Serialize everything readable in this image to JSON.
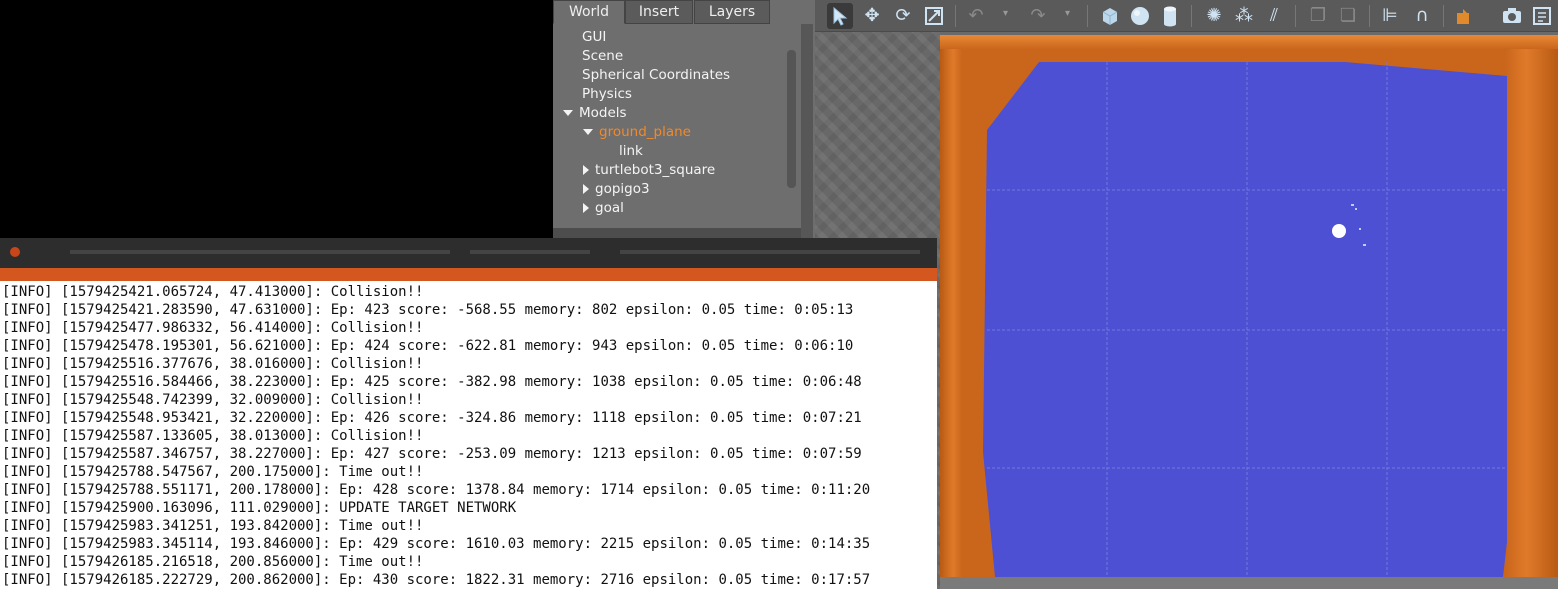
{
  "left_panel": {
    "tabs": [
      {
        "label": "World",
        "active": true
      },
      {
        "label": "Insert",
        "active": false
      },
      {
        "label": "Layers",
        "active": false
      }
    ],
    "tree": [
      {
        "label": "GUI",
        "level": 0,
        "arrow": "none",
        "selected": false
      },
      {
        "label": "Scene",
        "level": 0,
        "arrow": "none",
        "selected": false
      },
      {
        "label": "Spherical Coordinates",
        "level": 0,
        "arrow": "none",
        "selected": false
      },
      {
        "label": "Physics",
        "level": 0,
        "arrow": "none",
        "selected": false
      },
      {
        "label": "Models",
        "level": 0,
        "arrow": "down",
        "selected": false
      },
      {
        "label": "ground_plane",
        "level": 1,
        "arrow": "down",
        "selected": true
      },
      {
        "label": "link",
        "level": 2,
        "arrow": "none",
        "selected": false
      },
      {
        "label": "turtlebot3_square",
        "level": 1,
        "arrow": "right",
        "selected": false
      },
      {
        "label": "gopigo3",
        "level": 1,
        "arrow": "right",
        "selected": false
      },
      {
        "label": "goal",
        "level": 1,
        "arrow": "right",
        "selected": false
      }
    ]
  },
  "toolbar": {
    "icons": [
      "select-arrow-icon",
      "translate-icon",
      "rotate-icon",
      "scale-icon",
      "undo-icon",
      "redo-icon",
      "box-icon",
      "sphere-icon",
      "cylinder-icon",
      "point-light-icon",
      "spot-light-icon",
      "directional-light-icon",
      "copy-icon",
      "paste-icon",
      "align-icon",
      "snap-icon",
      "change-view-icon",
      "screenshot-icon",
      "log-icon"
    ]
  },
  "viewport": {
    "floor_color": "#4d50d2",
    "frame_color": "#c9661c",
    "ball_color": "#ffffff"
  },
  "terminal": {
    "lines": [
      "[INFO] [1579425421.065724, 47.413000]: Collision!!",
      "[INFO] [1579425421.283590, 47.631000]: Ep: 423 score: -568.55 memory: 802 epsilon: 0.05 time: 0:05:13",
      "[INFO] [1579425477.986332, 56.414000]: Collision!!",
      "[INFO] [1579425478.195301, 56.621000]: Ep: 424 score: -622.81 memory: 943 epsilon: 0.05 time: 0:06:10",
      "[INFO] [1579425516.377676, 38.016000]: Collision!!",
      "[INFO] [1579425516.584466, 38.223000]: Ep: 425 score: -382.98 memory: 1038 epsilon: 0.05 time: 0:06:48",
      "[INFO] [1579425548.742399, 32.009000]: Collision!!",
      "[INFO] [1579425548.953421, 32.220000]: Ep: 426 score: -324.86 memory: 1118 epsilon: 0.05 time: 0:07:21",
      "[INFO] [1579425587.133605, 38.013000]: Collision!!",
      "[INFO] [1579425587.346757, 38.227000]: Ep: 427 score: -253.09 memory: 1213 epsilon: 0.05 time: 0:07:59",
      "[INFO] [1579425788.547567, 200.175000]: Time out!!",
      "[INFO] [1579425788.551171, 200.178000]: Ep: 428 score: 1378.84 memory: 1714 epsilon: 0.05 time: 0:11:20",
      "[INFO] [1579425900.163096, 111.029000]: UPDATE TARGET NETWORK",
      "[INFO] [1579425983.341251, 193.842000]: Time out!!",
      "[INFO] [1579425983.345114, 193.846000]: Ep: 429 score: 1610.03 memory: 2215 epsilon: 0.05 time: 0:14:35",
      "[INFO] [1579426185.216518, 200.856000]: Time out!!",
      "[INFO] [1579426185.222729, 200.862000]: Ep: 430 score: 1822.31 memory: 2716 epsilon: 0.05 time: 0:17:57"
    ]
  }
}
